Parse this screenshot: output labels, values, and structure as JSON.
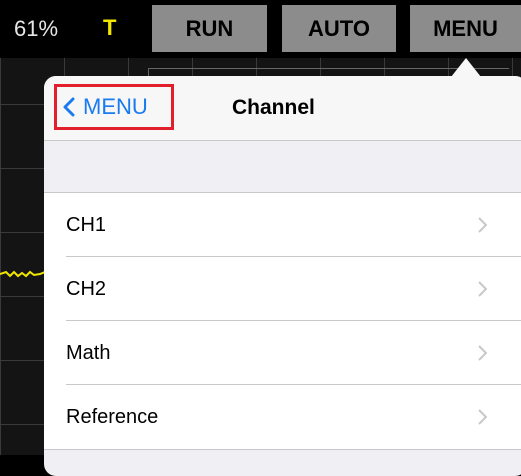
{
  "topbar": {
    "battery": "61%",
    "trigger_indicator": "T",
    "run_label": "RUN",
    "auto_label": "AUTO",
    "menu_label": "MENU"
  },
  "popover": {
    "back_label": "MENU",
    "title": "Channel",
    "items": [
      {
        "label": "CH1"
      },
      {
        "label": "CH2"
      },
      {
        "label": "Math"
      },
      {
        "label": "Reference"
      }
    ]
  },
  "colors": {
    "accent": "#1a7bf0",
    "highlight": "#e2202c",
    "trace": "#f2e600"
  },
  "icons": {
    "back": "chevron-left-icon",
    "disclosure": "chevron-right-icon"
  }
}
